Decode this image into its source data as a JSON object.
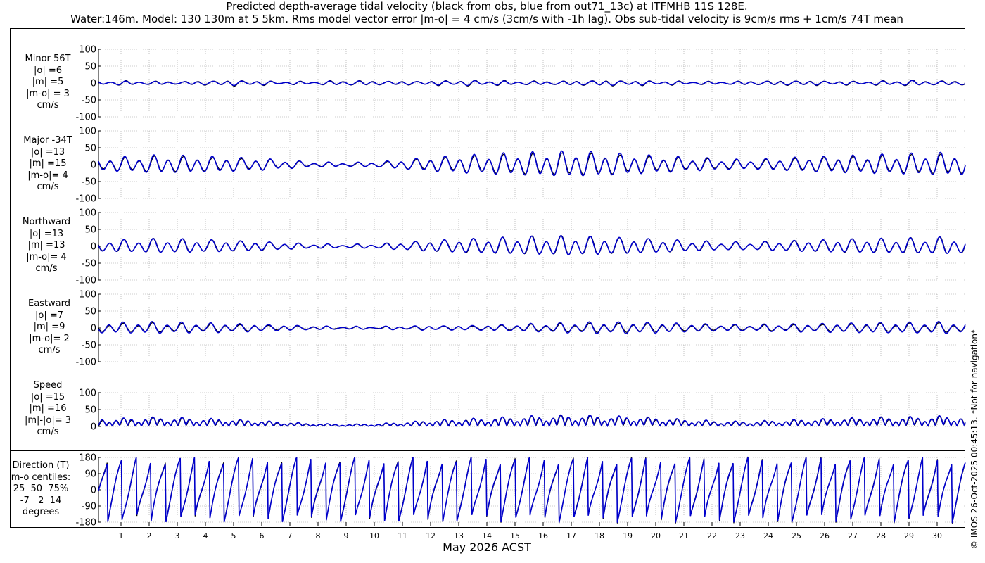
{
  "title_line1": "Predicted depth-average tidal velocity (black from obs, blue from out71_13c) at ITFMHB 11S 128E.",
  "title_line2": "Water:146m. Model: 130 130m at 5 5km. Rms model vector error |m-o| = 4 cm/s (3cm/s with -1h lag). Obs sub-tidal velocity is 9cm/s rms + 1cm/s 74T mean",
  "xlabel": "May 2026 ACST",
  "credit": "© IMOS 26-Oct-2025 00:45:13. *Not for navigation*",
  "colors": {
    "obs": "#000000",
    "model": "#0000cc",
    "grid": "#999999"
  },
  "panels": [
    {
      "id": "minor",
      "label_lines": [
        "Minor 56T",
        "|o| =6",
        "|m| =5",
        "|m-o| = 3",
        "cm/s"
      ],
      "yticks": [
        "100",
        "50",
        "0",
        "-50",
        "-100"
      ]
    },
    {
      "id": "major",
      "label_lines": [
        "Major -34T",
        "|o| =13",
        "|m| =15",
        "|m-o|= 4",
        "cm/s"
      ],
      "yticks": [
        "100",
        "50",
        "0",
        "-50",
        "-100"
      ]
    },
    {
      "id": "north",
      "label_lines": [
        "Northward",
        "|o| =13",
        "|m| =13",
        "|m-o|= 4",
        "cm/s"
      ],
      "yticks": [
        "100",
        "50",
        "0",
        "-50",
        "-100"
      ]
    },
    {
      "id": "east",
      "label_lines": [
        "Eastward",
        "|o| =7",
        "|m| =9",
        "|m-o|= 2",
        "cm/s"
      ],
      "yticks": [
        "100",
        "50",
        "0",
        "-50",
        "-100"
      ]
    },
    {
      "id": "speed",
      "label_lines": [
        "Speed",
        "|o| =15",
        "|m| =16",
        "|m|-|o|= 3",
        "cm/s"
      ],
      "yticks": [
        "100",
        "50",
        "0"
      ]
    },
    {
      "id": "direction",
      "label_lines": [
        "Direction (T)",
        "m-o centiles:",
        "25  50  75%",
        "-7   2  14",
        "degrees"
      ],
      "yticks": [
        "180",
        "90",
        "0",
        "-90",
        "-180"
      ]
    }
  ],
  "chart_data": {
    "type": "line",
    "x_unit": "day of May 2026 (ACST)",
    "x_ticks": [
      "1",
      "2",
      "3",
      "4",
      "5",
      "6",
      "7",
      "8",
      "9",
      "10",
      "11",
      "12",
      "13",
      "14",
      "15",
      "16",
      "17",
      "18",
      "19",
      "20",
      "21",
      "22",
      "23",
      "24",
      "25",
      "26",
      "27",
      "28",
      "29",
      "30"
    ],
    "xlim": [
      0.2,
      31
    ],
    "series_legend": {
      "obs": "black from obs",
      "model": "blue from out71_13c"
    },
    "panels": [
      {
        "name": "Minor 56T",
        "ylim": [
          -100,
          100
        ],
        "obs_rms": 6,
        "model_rms": 5,
        "diff_rms": 3,
        "amplitude_envelope_cm_s": [
          6,
          5,
          4,
          6,
          8,
          6,
          4,
          5,
          7,
          6,
          5,
          6,
          8,
          7,
          6,
          5,
          6,
          8,
          7,
          6,
          5,
          4,
          5,
          6,
          7,
          6,
          5,
          6,
          8,
          6
        ]
      },
      {
        "name": "Major -34T",
        "ylim": [
          -100,
          100
        ],
        "obs_rms": 13,
        "model_rms": 15,
        "diff_rms": 4,
        "amplitude_envelope_cm_s": [
          18,
          22,
          22,
          20,
          18,
          15,
          10,
          6,
          5,
          6,
          12,
          18,
          22,
          25,
          28,
          30,
          32,
          30,
          26,
          22,
          18,
          15,
          12,
          14,
          18,
          20,
          22,
          24,
          26,
          28
        ]
      },
      {
        "name": "Northward",
        "ylim": [
          -100,
          100
        ],
        "obs_rms": 13,
        "model_rms": 13,
        "diff_rms": 4,
        "amplitude_envelope_cm_s": [
          17,
          20,
          20,
          18,
          16,
          13,
          9,
          6,
          5,
          6,
          11,
          16,
          20,
          22,
          25,
          27,
          28,
          26,
          23,
          20,
          16,
          13,
          11,
          13,
          16,
          18,
          20,
          21,
          22,
          24
        ]
      },
      {
        "name": "Eastward",
        "ylim": [
          -100,
          100
        ],
        "obs_rms": 7,
        "model_rms": 9,
        "diff_rms": 2,
        "amplitude_envelope_cm_s": [
          12,
          13,
          12,
          11,
          10,
          8,
          6,
          4,
          3,
          3,
          4,
          5,
          5,
          6,
          8,
          10,
          12,
          13,
          13,
          12,
          10,
          8,
          7,
          8,
          9,
          10,
          11,
          12,
          12,
          13
        ]
      },
      {
        "name": "Speed",
        "ylim": [
          0,
          100
        ],
        "obs_rms": 15,
        "model_rms": 16,
        "diff_rms": 3
      },
      {
        "name": "Direction (T)",
        "ylim": [
          -180,
          180
        ],
        "centiles_m_minus_o": {
          "25": -7,
          "50": 2,
          "75": 14
        }
      }
    ]
  }
}
